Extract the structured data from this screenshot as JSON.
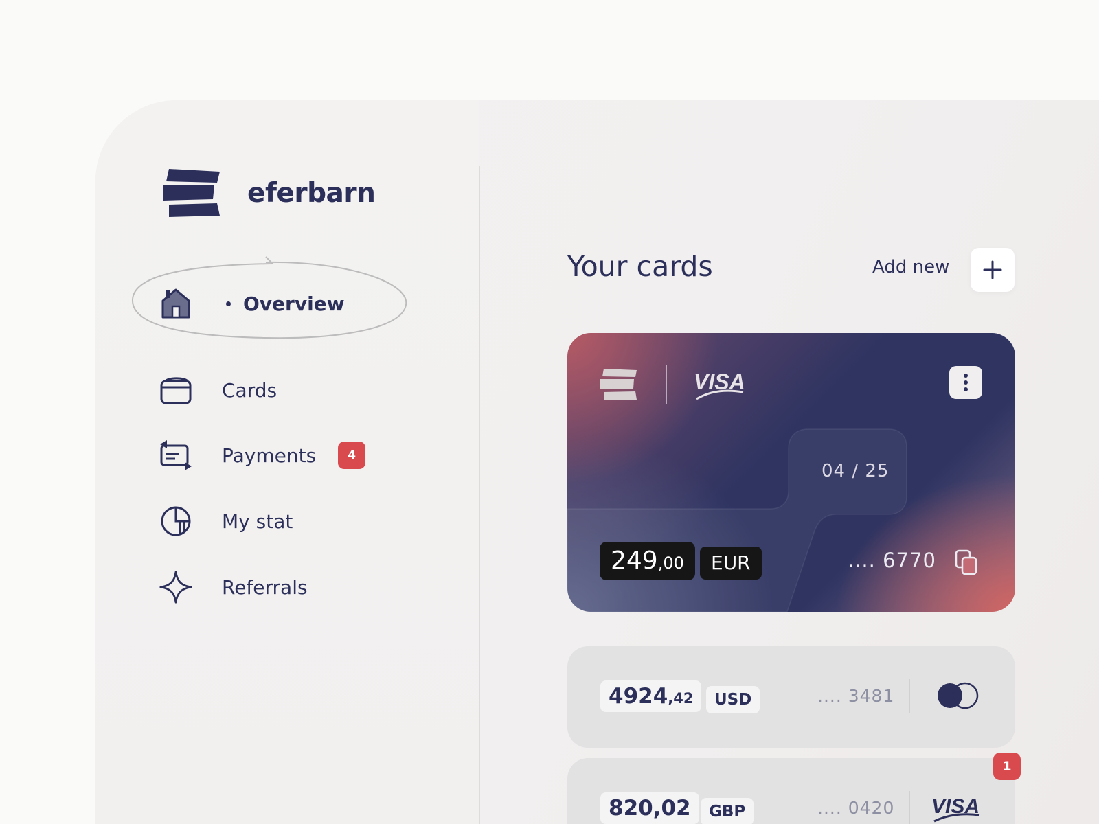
{
  "brand": {
    "name": "eferbarn"
  },
  "sidebar": {
    "items": [
      {
        "label": "Overview",
        "icon": "home-icon",
        "active": true
      },
      {
        "label": "Cards",
        "icon": "wallet-icon"
      },
      {
        "label": "Payments",
        "icon": "payments-icon",
        "badge": "4"
      },
      {
        "label": "My stat",
        "icon": "pie-chart-icon"
      },
      {
        "label": "Referrals",
        "icon": "sparkle-star-icon"
      }
    ]
  },
  "main": {
    "title": "Your cards",
    "add_new_label": "Add new",
    "primary_card": {
      "network": "VISA",
      "expiry": "04 / 25",
      "amount_int": "249",
      "amount_dec": ",00",
      "currency": "EUR",
      "number": ".... 6770"
    },
    "cards": [
      {
        "amount_int": "4924",
        "amount_dec": ",42",
        "currency": "USD",
        "number": ".... 3481",
        "network": "mastercard-icon"
      },
      {
        "amount_int": "820,02",
        "amount_dec": "",
        "currency": "GBP",
        "number": ".... 0420",
        "network": "VISA",
        "badge": "1"
      }
    ]
  },
  "colors": {
    "primary": "#2b2f5a",
    "badge": "#d94a4f",
    "background": "#fafaf8"
  }
}
